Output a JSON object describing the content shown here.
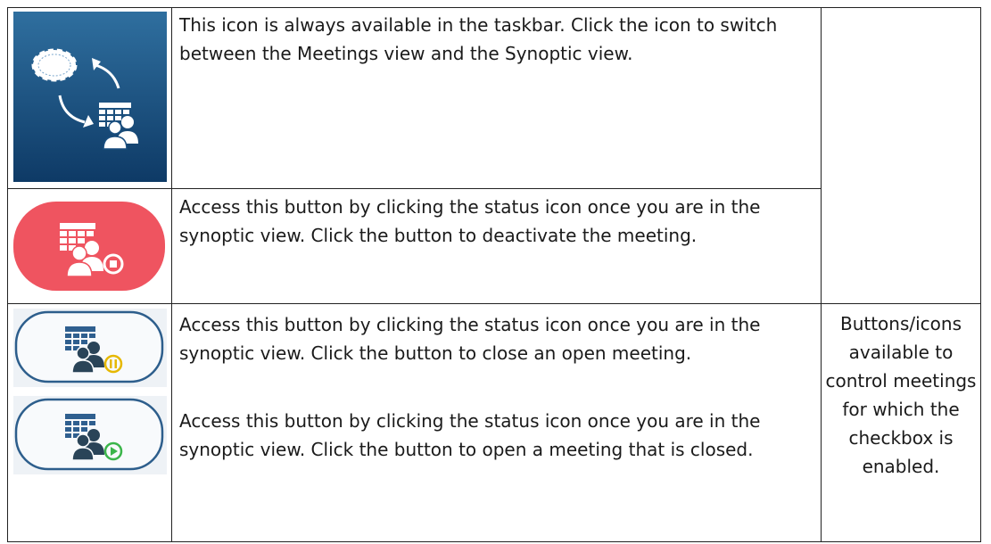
{
  "rows": [
    {
      "icon": "view-switch-icon",
      "description": "This icon is always available in the taskbar. Click the icon to switch between the Meetings view and the Synoptic view."
    },
    {
      "icon": "deactivate-meeting-icon",
      "description": "Access this button by clicking the status icon once you are in the synoptic view. Click the button to deactivate the meeting."
    },
    {
      "icon": "close-meeting-icon",
      "description": "Access this button by clicking the status icon once you are in the synoptic view. Click the button to close an open meeting."
    },
    {
      "icon": "open-meeting-icon",
      "description": "Access this button by clicking the status icon once you are in the synoptic view. Click the button to open a meeting that is closed."
    }
  ],
  "side_note": "Buttons/icons available to control meetings for which the checkbox is enabled.",
  "colors": {
    "switch_bg_top": "#2f6f9f",
    "switch_bg_bottom": "#0e3a66",
    "deactivate_bg": "#ef5460",
    "pause_accent": "#e6b800",
    "play_accent": "#3bb54a",
    "button_border": "#2d5e8c",
    "button_bg": "#eef2f6",
    "grid_blue": "#2f5f8f"
  }
}
